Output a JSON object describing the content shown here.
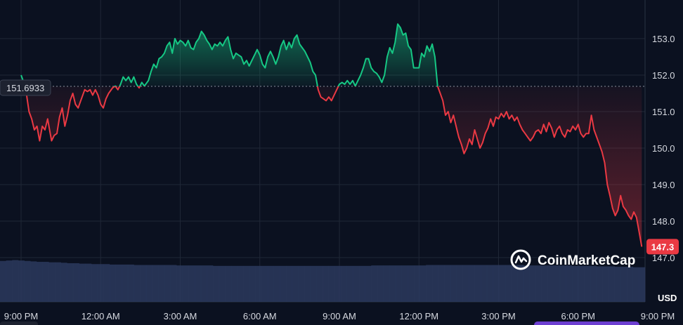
{
  "chart_data": {
    "type": "line",
    "currency_label": "USD",
    "baseline_value": 151.6933,
    "baseline_label": "151.6933",
    "last_price": 147.3,
    "last_price_label": "147.3",
    "y_ticks": [
      {
        "value": 153.0,
        "label": "153.0"
      },
      {
        "value": 152.0,
        "label": "152.0"
      },
      {
        "value": 151.0,
        "label": "151.0"
      },
      {
        "value": 150.0,
        "label": "150.0"
      },
      {
        "value": 149.0,
        "label": "149.0"
      },
      {
        "value": 148.0,
        "label": "148.0"
      },
      {
        "value": 147.0,
        "label": "147.0"
      }
    ],
    "x_ticks": [
      {
        "hour": 0,
        "label": "9:00 PM"
      },
      {
        "hour": 3,
        "label": "12:00 AM"
      },
      {
        "hour": 6,
        "label": "3:00 AM"
      },
      {
        "hour": 9,
        "label": "6:00 AM"
      },
      {
        "hour": 12,
        "label": "9:00 AM"
      },
      {
        "hour": 15,
        "label": "12:00 PM"
      },
      {
        "hour": 18,
        "label": "3:00 PM"
      },
      {
        "hour": 21,
        "label": "6:00 PM"
      },
      {
        "hour": 24,
        "label": "9:00 PM"
      }
    ],
    "series": [
      {
        "points": [
          [
            0.0,
            152.0
          ],
          [
            0.1,
            151.8
          ],
          [
            0.2,
            151.5
          ],
          [
            0.3,
            151.0
          ],
          [
            0.4,
            150.8
          ],
          [
            0.5,
            150.5
          ],
          [
            0.6,
            150.6
          ],
          [
            0.7,
            150.2
          ],
          [
            0.8,
            150.6
          ],
          [
            0.9,
            150.5
          ],
          [
            1.0,
            150.8
          ],
          [
            1.1,
            150.4
          ],
          [
            1.15,
            150.2
          ],
          [
            1.25,
            150.35
          ],
          [
            1.35,
            150.4
          ],
          [
            1.45,
            150.85
          ],
          [
            1.55,
            151.1
          ],
          [
            1.65,
            150.6
          ],
          [
            1.75,
            150.9
          ],
          [
            1.85,
            151.3
          ],
          [
            1.95,
            151.5
          ],
          [
            2.05,
            151.2
          ],
          [
            2.15,
            151.1
          ],
          [
            2.25,
            151.3
          ],
          [
            2.4,
            151.6
          ],
          [
            2.5,
            151.55
          ],
          [
            2.6,
            151.6
          ],
          [
            2.7,
            151.45
          ],
          [
            2.8,
            151.6
          ],
          [
            2.9,
            151.45
          ],
          [
            3.0,
            151.2
          ],
          [
            3.1,
            151.1
          ],
          [
            3.2,
            151.35
          ],
          [
            3.3,
            151.5
          ],
          [
            3.45,
            151.65
          ],
          [
            3.55,
            151.7
          ],
          [
            3.65,
            151.6
          ],
          [
            3.75,
            151.75
          ],
          [
            3.85,
            151.95
          ],
          [
            3.95,
            151.85
          ],
          [
            4.05,
            151.95
          ],
          [
            4.15,
            151.8
          ],
          [
            4.25,
            151.95
          ],
          [
            4.35,
            151.75
          ],
          [
            4.45,
            151.65
          ],
          [
            4.55,
            151.8
          ],
          [
            4.65,
            151.7
          ],
          [
            4.8,
            151.85
          ],
          [
            4.9,
            152.1
          ],
          [
            5.0,
            152.3
          ],
          [
            5.1,
            152.2
          ],
          [
            5.2,
            152.45
          ],
          [
            5.3,
            152.5
          ],
          [
            5.4,
            152.6
          ],
          [
            5.5,
            152.8
          ],
          [
            5.6,
            152.9
          ],
          [
            5.7,
            152.6
          ],
          [
            5.8,
            153.0
          ],
          [
            5.9,
            152.85
          ],
          [
            6.0,
            152.95
          ],
          [
            6.1,
            152.9
          ],
          [
            6.2,
            152.8
          ],
          [
            6.3,
            152.95
          ],
          [
            6.4,
            152.75
          ],
          [
            6.5,
            152.7
          ],
          [
            6.6,
            152.9
          ],
          [
            6.7,
            153.0
          ],
          [
            6.8,
            153.2
          ],
          [
            6.9,
            153.1
          ],
          [
            7.0,
            152.95
          ],
          [
            7.1,
            152.85
          ],
          [
            7.2,
            152.7
          ],
          [
            7.3,
            152.85
          ],
          [
            7.4,
            152.8
          ],
          [
            7.5,
            152.9
          ],
          [
            7.6,
            152.8
          ],
          [
            7.7,
            152.95
          ],
          [
            7.8,
            153.05
          ],
          [
            7.9,
            152.7
          ],
          [
            8.0,
            152.45
          ],
          [
            8.1,
            152.6
          ],
          [
            8.2,
            152.55
          ],
          [
            8.3,
            152.5
          ],
          [
            8.4,
            152.3
          ],
          [
            8.5,
            152.4
          ],
          [
            8.6,
            152.25
          ],
          [
            8.7,
            152.4
          ],
          [
            8.8,
            152.55
          ],
          [
            8.9,
            152.7
          ],
          [
            9.0,
            152.55
          ],
          [
            9.1,
            152.3
          ],
          [
            9.2,
            152.2
          ],
          [
            9.3,
            152.5
          ],
          [
            9.4,
            152.65
          ],
          [
            9.5,
            152.5
          ],
          [
            9.6,
            152.3
          ],
          [
            9.7,
            152.5
          ],
          [
            9.8,
            152.8
          ],
          [
            9.9,
            152.95
          ],
          [
            10.0,
            152.7
          ],
          [
            10.1,
            152.9
          ],
          [
            10.2,
            152.75
          ],
          [
            10.3,
            153.0
          ],
          [
            10.4,
            153.1
          ],
          [
            10.5,
            152.85
          ],
          [
            10.6,
            152.75
          ],
          [
            10.7,
            152.65
          ],
          [
            10.8,
            152.5
          ],
          [
            10.9,
            152.35
          ],
          [
            11.0,
            152.1
          ],
          [
            11.1,
            152.0
          ],
          [
            11.2,
            151.6
          ],
          [
            11.3,
            151.4
          ],
          [
            11.4,
            151.35
          ],
          [
            11.5,
            151.3
          ],
          [
            11.6,
            151.4
          ],
          [
            11.7,
            151.3
          ],
          [
            11.8,
            151.45
          ],
          [
            11.9,
            151.6
          ],
          [
            12.0,
            151.75
          ],
          [
            12.1,
            151.8
          ],
          [
            12.2,
            151.75
          ],
          [
            12.3,
            151.85
          ],
          [
            12.4,
            151.75
          ],
          [
            12.5,
            151.85
          ],
          [
            12.6,
            151.7
          ],
          [
            12.7,
            151.85
          ],
          [
            12.8,
            152.0
          ],
          [
            12.9,
            152.2
          ],
          [
            13.0,
            152.45
          ],
          [
            13.1,
            152.45
          ],
          [
            13.2,
            152.2
          ],
          [
            13.3,
            152.1
          ],
          [
            13.4,
            152.05
          ],
          [
            13.5,
            151.95
          ],
          [
            13.6,
            151.8
          ],
          [
            13.7,
            152.0
          ],
          [
            13.8,
            152.5
          ],
          [
            13.9,
            152.75
          ],
          [
            14.0,
            152.6
          ],
          [
            14.1,
            152.9
          ],
          [
            14.2,
            153.4
          ],
          [
            14.3,
            153.3
          ],
          [
            14.4,
            153.1
          ],
          [
            14.5,
            153.15
          ],
          [
            14.6,
            152.8
          ],
          [
            14.7,
            152.7
          ],
          [
            14.8,
            152.2
          ],
          [
            14.9,
            152.2
          ],
          [
            15.0,
            152.2
          ],
          [
            15.1,
            152.6
          ],
          [
            15.2,
            152.5
          ],
          [
            15.3,
            152.8
          ],
          [
            15.4,
            152.65
          ],
          [
            15.5,
            152.85
          ],
          [
            15.6,
            152.5
          ],
          [
            15.7,
            151.7
          ],
          [
            15.8,
            151.5
          ],
          [
            15.9,
            151.3
          ],
          [
            16.0,
            150.9
          ],
          [
            16.1,
            151.0
          ],
          [
            16.2,
            150.7
          ],
          [
            16.3,
            150.9
          ],
          [
            16.4,
            150.6
          ],
          [
            16.5,
            150.3
          ],
          [
            16.6,
            150.1
          ],
          [
            16.7,
            149.85
          ],
          [
            16.8,
            150.0
          ],
          [
            16.9,
            150.25
          ],
          [
            17.0,
            150.1
          ],
          [
            17.1,
            150.5
          ],
          [
            17.2,
            150.25
          ],
          [
            17.3,
            150.0
          ],
          [
            17.4,
            150.15
          ],
          [
            17.5,
            150.4
          ],
          [
            17.6,
            150.55
          ],
          [
            17.7,
            150.8
          ],
          [
            17.8,
            150.6
          ],
          [
            17.9,
            150.85
          ],
          [
            18.0,
            150.8
          ],
          [
            18.1,
            150.95
          ],
          [
            18.2,
            150.85
          ],
          [
            18.3,
            151.0
          ],
          [
            18.4,
            150.8
          ],
          [
            18.5,
            150.9
          ],
          [
            18.6,
            150.75
          ],
          [
            18.7,
            150.85
          ],
          [
            18.8,
            150.65
          ],
          [
            18.9,
            150.5
          ],
          [
            19.0,
            150.4
          ],
          [
            19.1,
            150.3
          ],
          [
            19.2,
            150.2
          ],
          [
            19.3,
            150.3
          ],
          [
            19.4,
            150.45
          ],
          [
            19.5,
            150.5
          ],
          [
            19.6,
            150.4
          ],
          [
            19.7,
            150.65
          ],
          [
            19.8,
            150.45
          ],
          [
            19.9,
            150.7
          ],
          [
            20.0,
            150.55
          ],
          [
            20.1,
            150.3
          ],
          [
            20.2,
            150.5
          ],
          [
            20.3,
            150.6
          ],
          [
            20.4,
            150.4
          ],
          [
            20.5,
            150.3
          ],
          [
            20.6,
            150.5
          ],
          [
            20.7,
            150.45
          ],
          [
            20.8,
            150.6
          ],
          [
            20.9,
            150.5
          ],
          [
            21.0,
            150.65
          ],
          [
            21.1,
            150.4
          ],
          [
            21.2,
            150.3
          ],
          [
            21.3,
            150.4
          ],
          [
            21.4,
            150.4
          ],
          [
            21.5,
            150.9
          ],
          [
            21.6,
            150.5
          ],
          [
            21.7,
            150.3
          ],
          [
            21.8,
            150.1
          ],
          [
            21.9,
            149.9
          ],
          [
            22.0,
            149.6
          ],
          [
            22.1,
            149.0
          ],
          [
            22.2,
            148.7
          ],
          [
            22.3,
            148.35
          ],
          [
            22.4,
            148.15
          ],
          [
            22.5,
            148.3
          ],
          [
            22.6,
            148.7
          ],
          [
            22.7,
            148.4
          ],
          [
            22.8,
            148.3
          ],
          [
            22.9,
            148.15
          ],
          [
            23.0,
            148.05
          ],
          [
            23.1,
            148.25
          ],
          [
            23.2,
            148.1
          ],
          [
            23.3,
            147.7
          ],
          [
            23.4,
            147.3
          ]
        ]
      }
    ],
    "volume": [
      0.91,
      0.92,
      0.93,
      0.92,
      0.91,
      0.9,
      0.89,
      0.89,
      0.88,
      0.88,
      0.87,
      0.86,
      0.86,
      0.85,
      0.85,
      0.84,
      0.84,
      0.84,
      0.83,
      0.83,
      0.83,
      0.83,
      0.82,
      0.82,
      0.82,
      0.82,
      0.82,
      0.82,
      0.82,
      0.81,
      0.81,
      0.81,
      0.81,
      0.81,
      0.81,
      0.8,
      0.8,
      0.8,
      0.8,
      0.8,
      0.8,
      0.8,
      0.8,
      0.8,
      0.8,
      0.8,
      0.8,
      0.8,
      0.8,
      0.8,
      0.8,
      0.8,
      0.8,
      0.8,
      0.8,
      0.8,
      0.8,
      0.8,
      0.8,
      0.8,
      0.8,
      0.81,
      0.81,
      0.81,
      0.81,
      0.81,
      0.81,
      0.81,
      0.81,
      0.81,
      0.82,
      0.82,
      0.82,
      0.82,
      0.82,
      0.82,
      0.82,
      0.82,
      0.82,
      0.82,
      0.82,
      0.82,
      0.82,
      0.82,
      0.82,
      0.82,
      0.81,
      0.81,
      0.81,
      0.81,
      0.81,
      0.81,
      0.81,
      0.81,
      0.8,
      0.8,
      0.8,
      0.8,
      0.79,
      0.79,
      0.79,
      0.78,
      0.78,
      0.78,
      0.77,
      0.77
    ],
    "y_axis_range": [
      146.1,
      153.9
    ],
    "x_axis_range": [
      0,
      24
    ],
    "grid": true,
    "colors": {
      "up": "#16c784",
      "down": "#ea3943",
      "up_fill": "#0d5f40",
      "down_fill": "#5a1a24",
      "volume": "#2c3a5e",
      "grid": "#1f2736",
      "baseline": "#8a8f9c",
      "background": "#0b1120"
    }
  },
  "brand": {
    "name": "CoinMarketCap",
    "icon": "coinmarketcap-logo-icon"
  }
}
